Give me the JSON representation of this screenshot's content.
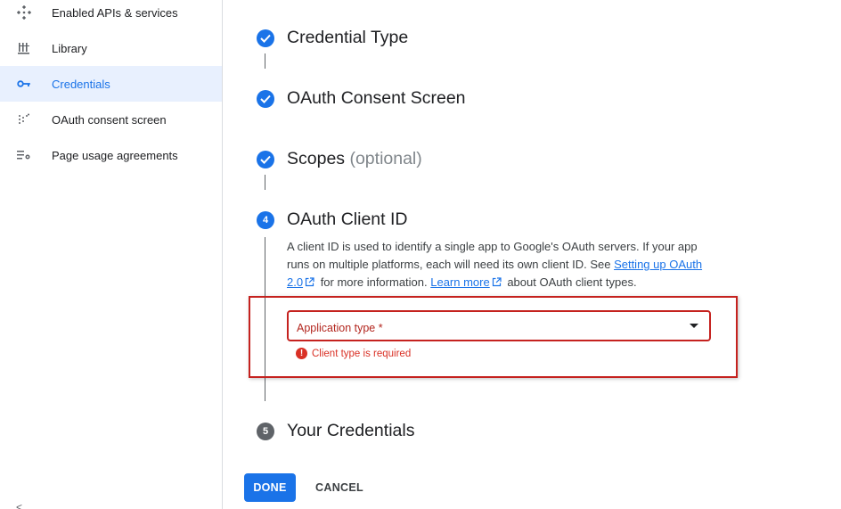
{
  "sidebar": {
    "items": [
      {
        "label": "Enabled APIs & services",
        "icon": "apis-services-icon",
        "active": false
      },
      {
        "label": "Library",
        "icon": "library-icon",
        "active": false
      },
      {
        "label": "Credentials",
        "icon": "key-icon",
        "active": true
      },
      {
        "label": "OAuth consent screen",
        "icon": "consent-screen-icon",
        "active": false
      },
      {
        "label": "Page usage agreements",
        "icon": "settings-list-icon",
        "active": false
      }
    ],
    "collapse_glyph": "<"
  },
  "stepper": {
    "steps": [
      {
        "title": "Credential Type",
        "state": "complete"
      },
      {
        "title": "OAuth Consent Screen",
        "state": "complete"
      },
      {
        "title": "Scopes",
        "optional": "(optional)",
        "state": "complete"
      },
      {
        "number": "4",
        "title": "OAuth Client ID",
        "state": "current"
      },
      {
        "number": "5",
        "title": "Your Credentials",
        "state": "todo"
      }
    ]
  },
  "client_id_step": {
    "description_1": "A client ID is used to identify a single app to Google's OAuth servers. If your app runs on multiple platforms, each will need its own client ID. See ",
    "setup_link": "Setting up OAuth 2.0",
    "description_2": " for more information. ",
    "learn_more_link": "Learn more",
    "description_3": " about OAuth client types.",
    "application_type_label": "Application type *",
    "error_message": "Client type is required"
  },
  "actions": {
    "done_label": "DONE",
    "cancel_label": "CANCEL"
  },
  "colors": {
    "accent": "#1a73e8",
    "error": "#d93025",
    "highlight_box": "#c5221f",
    "active_nav_bg": "#e8f0fe"
  }
}
